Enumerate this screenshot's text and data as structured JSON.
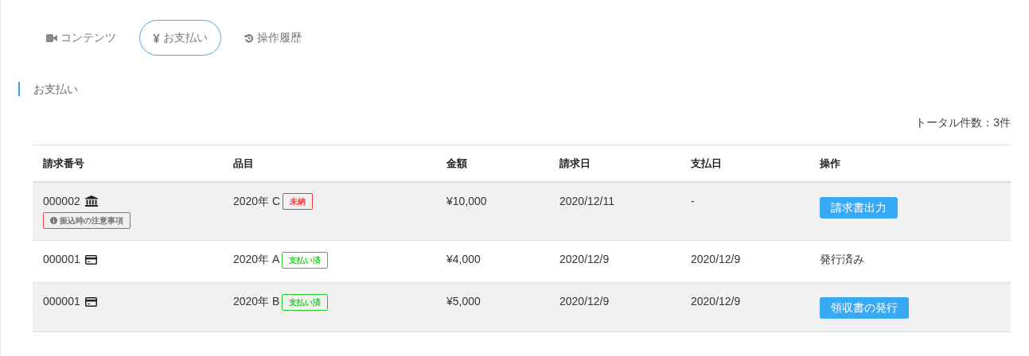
{
  "tabs": [
    {
      "label": "コンテンツ",
      "selected": false
    },
    {
      "label": "お支払い",
      "selected": true
    },
    {
      "label": "操作履歴",
      "selected": false
    }
  ],
  "section_title": "お支払い",
  "total_count": "トータル件数：3件",
  "table": {
    "columns": [
      "請求番号",
      "品目",
      "金額",
      "請求日",
      "支払日",
      "操作"
    ],
    "rows": [
      {
        "kind": "bank",
        "number": "000002",
        "notice": "振込時の注意事項",
        "item": "2020年 C",
        "status": {
          "label": "未納",
          "kind": "unpaid"
        },
        "amount": "¥10,000",
        "billed": "2020/12/11",
        "paid": "-",
        "action": {
          "kind": "button",
          "label": "請求書出力"
        }
      },
      {
        "kind": "card",
        "number": "000001",
        "item": "2020年 A",
        "status": {
          "label": "支払い済",
          "kind": "paid"
        },
        "amount": "¥4,000",
        "billed": "2020/12/9",
        "paid": "2020/12/9",
        "action": {
          "kind": "text",
          "label": "発行済み"
        }
      },
      {
        "kind": "card",
        "number": "000001",
        "item": "2020年 B",
        "status": {
          "label": "支払い済",
          "kind": "paid"
        },
        "amount": "¥5,000",
        "billed": "2020/12/9",
        "paid": "2020/12/9",
        "action": {
          "kind": "button",
          "label": "領収書の発行"
        }
      }
    ]
  }
}
